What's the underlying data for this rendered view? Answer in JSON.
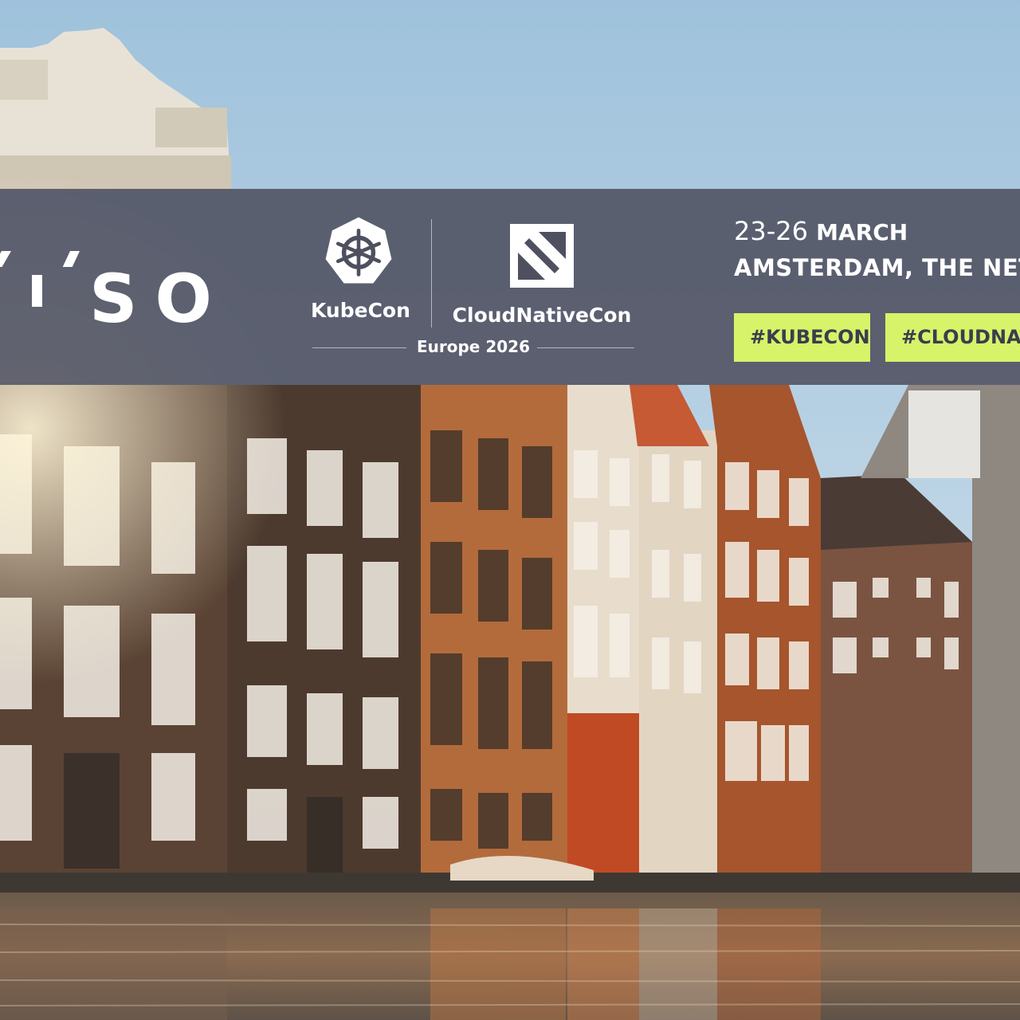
{
  "brand": {
    "logo_text": "SO"
  },
  "event": {
    "kubecon_label": "KubeCon",
    "cloudnativecon_label": "CloudNativeCon",
    "edition": "Europe 2026",
    "dates": "23-26",
    "month": "MARCH",
    "location": "AMSTERDAM, THE NETH"
  },
  "hashtags": [
    "#KUBECON",
    "#CLOUDNATI"
  ],
  "colors": {
    "banner": "#4e5060",
    "tag_bg": "#d6f36a",
    "tag_text": "#3b3d4d"
  }
}
